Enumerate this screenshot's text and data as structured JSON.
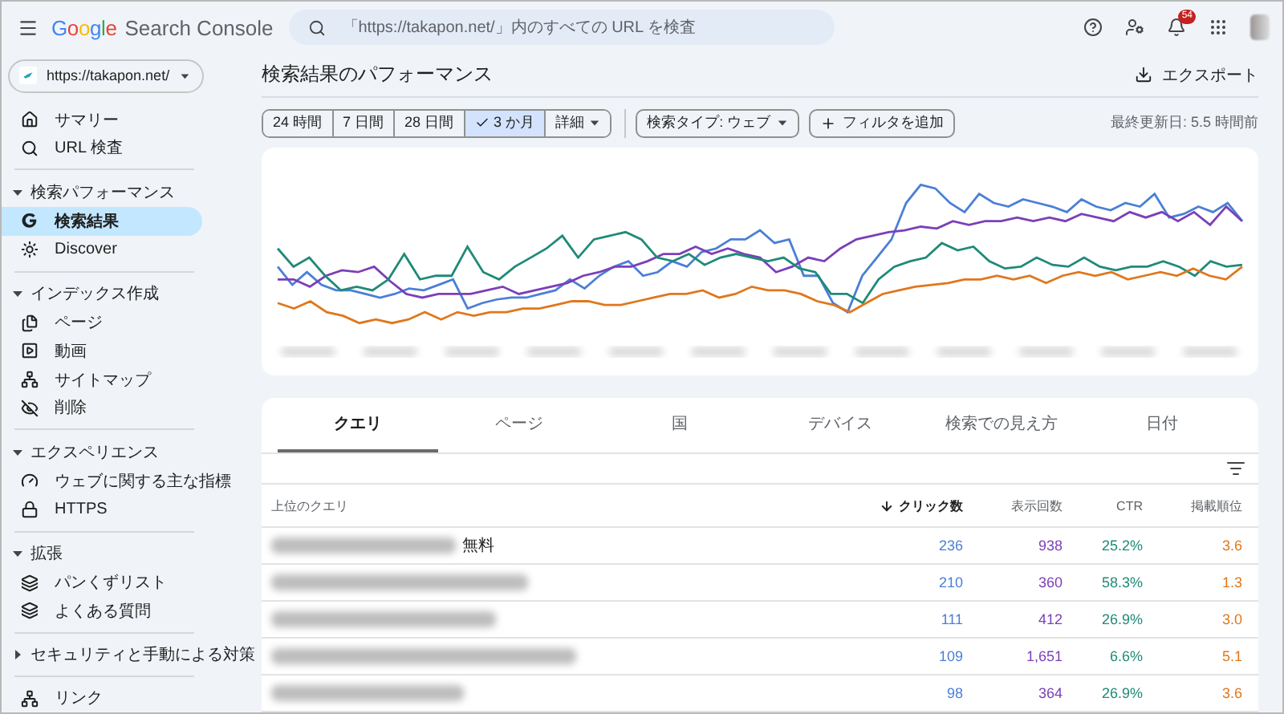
{
  "header": {
    "logo": "Google",
    "product": "Search Console",
    "search_placeholder": "「https://takapon.net/」内のすべての URL を検査",
    "notification_count": "54"
  },
  "property": "https://takapon.net/",
  "sidebar": {
    "top_items": [
      {
        "label": "サマリー",
        "selected": false
      },
      {
        "label": "URL 検査",
        "selected": false
      }
    ],
    "sections": [
      {
        "title": "検索パフォーマンス",
        "expanded": true,
        "items": [
          {
            "label": "検索結果",
            "selected": true
          },
          {
            "label": "Discover",
            "selected": false
          }
        ]
      },
      {
        "title": "インデックス作成",
        "expanded": true,
        "items": [
          {
            "label": "ページ",
            "selected": false
          },
          {
            "label": "動画",
            "selected": false
          },
          {
            "label": "サイトマップ",
            "selected": false
          },
          {
            "label": "削除",
            "selected": false
          }
        ]
      },
      {
        "title": "エクスペリエンス",
        "expanded": true,
        "items": [
          {
            "label": "ウェブに関する主な指標",
            "selected": false
          },
          {
            "label": "HTTPS",
            "selected": false
          }
        ]
      },
      {
        "title": "拡張",
        "expanded": true,
        "items": [
          {
            "label": "パンくずリスト",
            "selected": false
          },
          {
            "label": "よくある質問",
            "selected": false
          }
        ]
      },
      {
        "title": "セキュリティと手動による対策",
        "expanded": false
      }
    ],
    "bottom_items": [
      {
        "label": "リンク",
        "selected": false
      }
    ]
  },
  "page": {
    "title": "検索結果のパフォーマンス",
    "export": "エクスポート",
    "date_ranges": [
      {
        "label": "24 時間",
        "selected": false
      },
      {
        "label": "7 日間",
        "selected": false
      },
      {
        "label": "28 日間",
        "selected": false
      },
      {
        "label": "3 か月",
        "selected": true
      }
    ],
    "more": "詳細",
    "search_type": "検索タイプ: ウェブ",
    "add_filter": "フィルタを追加",
    "last_updated": "最終更新日: 5.5 時間前"
  },
  "table": {
    "tabs": [
      {
        "label": "クエリ",
        "selected": true
      },
      {
        "label": "ページ",
        "selected": false
      },
      {
        "label": "国",
        "selected": false
      },
      {
        "label": "デバイス",
        "selected": false
      },
      {
        "label": "検索での見え方",
        "selected": false
      },
      {
        "label": "日付",
        "selected": false
      }
    ],
    "columns": [
      {
        "label": "上位のクエリ",
        "sorted": false
      },
      {
        "label": "クリック数",
        "sorted": true,
        "color": "#4a7fd6"
      },
      {
        "label": "表示回数",
        "sorted": false,
        "color": "#7b3fb8"
      },
      {
        "label": "CTR",
        "sorted": false,
        "color": "#1f8a78"
      },
      {
        "label": "掲載順位",
        "sorted": false,
        "color": "#e0771c"
      }
    ],
    "rows": [
      {
        "cells": [
          "無料",
          "236",
          "938",
          "25.2%",
          "3.6"
        ]
      },
      {
        "cells": [
          "",
          "210",
          "360",
          "58.3%",
          "1.3"
        ]
      },
      {
        "cells": [
          "",
          "111",
          "412",
          "26.9%",
          "3.0"
        ]
      },
      {
        "cells": [
          "",
          "109",
          "1,651",
          "6.6%",
          "5.1"
        ]
      },
      {
        "cells": [
          "",
          "98",
          "364",
          "26.9%",
          "3.6"
        ]
      }
    ]
  }
}
